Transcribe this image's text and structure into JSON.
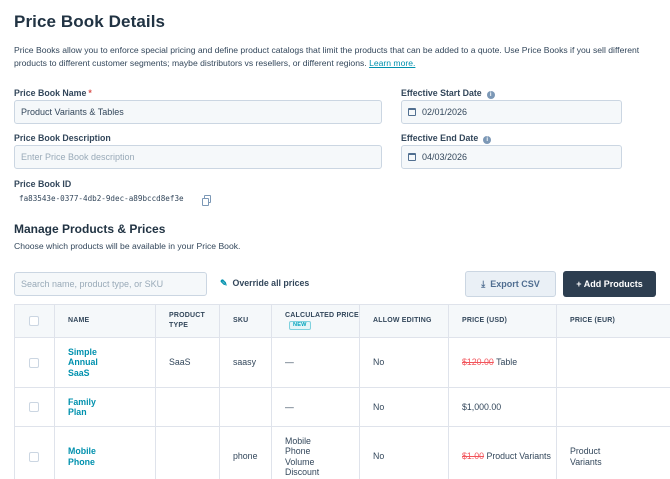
{
  "page": {
    "title": "Price Book Details",
    "description": "Price Books allow you to enforce special pricing and define product catalogs that limit the products that can be added to a quote. Use Price Books if you sell different products to different customer segments; maybe distributors vs resellers, or different regions.",
    "learn_more": "Learn more."
  },
  "form": {
    "name_label": "Price Book Name",
    "name_required": "*",
    "name_value": "Product Variants & Tables",
    "description_label": "Price Book Description",
    "description_placeholder": "Enter Price Book description",
    "id_label": "Price Book ID",
    "id_value": "fa83543e-0377-4db2-9dec-a89bccd8ef3e",
    "start_label": "Effective Start Date",
    "start_value": "02/01/2026",
    "end_label": "Effective End Date",
    "end_value": "04/03/2026"
  },
  "products": {
    "title": "Manage Products & Prices",
    "subtitle": "Choose which products will be available in your Price Book.",
    "search_placeholder": "Search name, product type, or SKU",
    "override_label": "Override all prices",
    "export_label": "Export CSV",
    "add_label": "+ Add Products",
    "columns": {
      "name": "NAME",
      "type": "PRODUCT TYPE",
      "sku": "SKU",
      "calc": "CALCULATED PRICE",
      "calc_badge": "NEW",
      "allow": "ALLOW EDITING",
      "usd": "PRICE (USD)",
      "eur": "PRICE (EUR)"
    },
    "rows": [
      {
        "name": "Simple Annual SaaS",
        "type": "SaaS",
        "sku": "saasy",
        "calc": "—",
        "allow": "No",
        "usd_strike": "$120.00",
        "usd": " Table",
        "eur": ""
      },
      {
        "name": "Family Plan",
        "type": "",
        "sku": "",
        "calc": "—",
        "allow": "No",
        "usd_strike": "",
        "usd": "$1,000.00",
        "eur": ""
      },
      {
        "name": "Mobile Phone",
        "type": "",
        "sku": "phone",
        "calc": "Mobile Phone Volume Discount",
        "allow": "No",
        "usd_strike": "$1.00",
        "usd": " Product Variants",
        "eur": "Product Variants"
      }
    ]
  },
  "colors": {
    "link": "#0091ae",
    "primary_button": "#2d3e50",
    "strike": "#f2545b"
  }
}
